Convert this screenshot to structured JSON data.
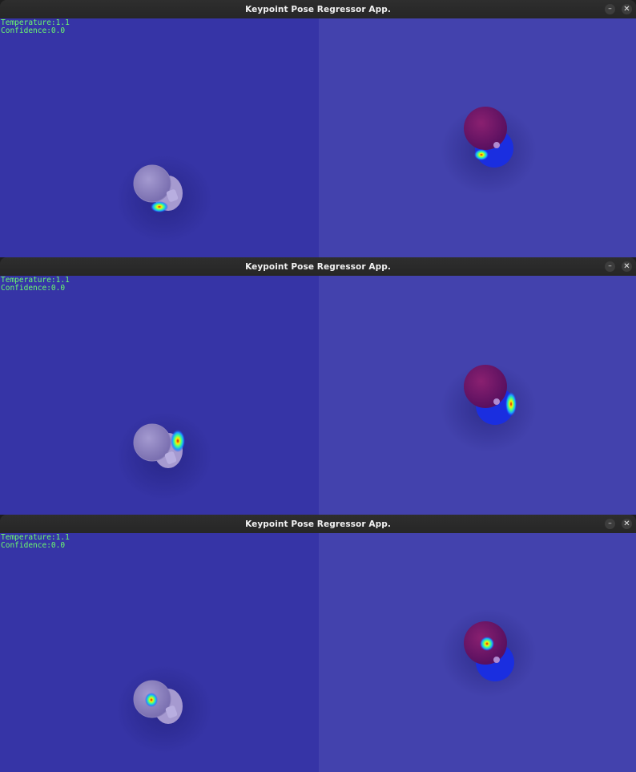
{
  "windows": [
    {
      "title": "Keypoint Pose Regressor App.",
      "minimize_glyph": "–",
      "close_glyph": "✕",
      "temperature_text": "Temperature:1.1",
      "confidence_text": "Confidence:0.0",
      "icons": [
        "minimize-icon",
        "close-icon"
      ]
    },
    {
      "title": "Keypoint Pose Regressor App.",
      "minimize_glyph": "–",
      "close_glyph": "✕",
      "temperature_text": "Temperature:1.1",
      "confidence_text": "Confidence:0.0",
      "icons": [
        "minimize-icon",
        "close-icon"
      ]
    },
    {
      "title": "Keypoint Pose Regressor App.",
      "minimize_glyph": "–",
      "close_glyph": "✕",
      "temperature_text": "Temperature:1.1",
      "confidence_text": "Confidence:0.0",
      "icons": [
        "minimize-icon",
        "close-icon"
      ]
    }
  ],
  "colors": {
    "titlebar": "#2b2b2b",
    "left_pane": "#3634a6",
    "right_pane": "#4342ad",
    "overlay_text": "#6dfb6d"
  }
}
